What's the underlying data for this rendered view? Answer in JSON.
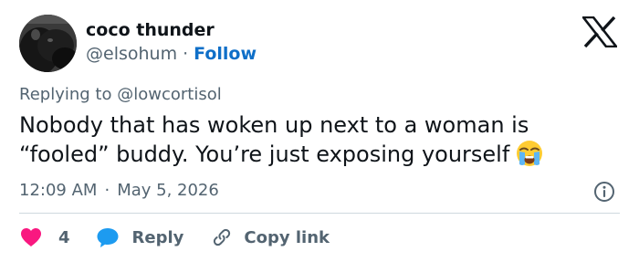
{
  "author": {
    "name": "coco thunder",
    "handle": "@elsohum",
    "separator": "·",
    "follow_label": "Follow",
    "avatar_icon": "dog-avatar"
  },
  "platform": {
    "logo_icon": "x-logo-icon"
  },
  "reply_context": {
    "prefix": "Replying to",
    "mention": "@lowcortisol"
  },
  "tweet": {
    "line1": "Nobody that has woken up next to a woman is",
    "line2": "“fooled” buddy. You’re just exposing yourself",
    "emoji_icon": "loudly-crying-face-emoji",
    "time": "12:09 AM",
    "separator": "·",
    "date": "May 5, 2026"
  },
  "actions": {
    "like_count": "4",
    "reply_label": "Reply",
    "copy_link_label": "Copy link",
    "like_icon": "heart-icon",
    "reply_icon": "speech-bubble-icon",
    "copy_icon": "link-icon",
    "info_icon": "info-icon"
  },
  "colors": {
    "heart": "#f91880",
    "reply_bubble": "#1d9bf0",
    "follow": "#0f6fc8",
    "secondary_text": "#536471",
    "primary_text": "#0f1419"
  }
}
